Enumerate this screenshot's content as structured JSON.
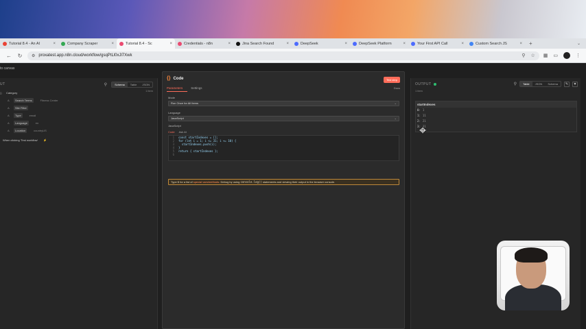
{
  "browser": {
    "tabs": [
      {
        "title": "Tutorial 8.4 - An AI",
        "color": "#ea4335",
        "active": false
      },
      {
        "title": "Company Scraper",
        "color": "#34a853",
        "active": false
      },
      {
        "title": "Tutorial 8.4 - Sc",
        "color": "#ea4b71",
        "active": true
      },
      {
        "title": "Credentials - n8n",
        "color": "#ea4b71",
        "active": false
      },
      {
        "title": "Jina Search Found",
        "color": "#111111",
        "active": false
      },
      {
        "title": "DeepSeek",
        "color": "#4d6bfe",
        "active": false
      },
      {
        "title": "DeepSeek Platform",
        "color": "#4d6bfe",
        "active": false
      },
      {
        "title": "Your First API Call",
        "color": "#4d6bfe",
        "active": false
      },
      {
        "title": "Custom Search JS",
        "color": "#4285f4",
        "active": false
      }
    ],
    "new_tab": "+",
    "url": "proxatest.app.n8n.cloud/workflow/gsqPtLl0xJl7Xwk"
  },
  "app": {
    "back_link": "to canvas",
    "input": {
      "title": "UT",
      "views": [
        "Schema",
        "Table",
        "JSON"
      ],
      "count": "1 item",
      "fields": [
        {
          "type": "{}",
          "key": "Category",
          "value": "",
          "sub": false
        },
        {
          "type": "A",
          "key": "Search Terms",
          "value": "Fitness Center",
          "sub": true
        },
        {
          "type": "A",
          "key": "Site Filter",
          "value": "",
          "sub": true
        },
        {
          "type": "A",
          "key": "Type",
          "value": "email",
          "sub": true
        },
        {
          "type": "A",
          "key": "Language",
          "value": "en",
          "sub": true
        },
        {
          "type": "A",
          "key": "Location",
          "value": "countryUS",
          "sub": true
        }
      ],
      "trigger": "When clicking 'Test workflow'"
    },
    "code": {
      "title": "Code",
      "test_button": "Test step",
      "docs": "Docs",
      "tabs": [
        "Parameters",
        "Settings"
      ],
      "mode_label": "Mode",
      "mode_value": "Run Once for All Items",
      "language_label": "Language",
      "language_value": "JavaScript",
      "js_label": "JavaScript",
      "editor_tabs": [
        "Code",
        "Ask AI"
      ],
      "lines": [
        {
          "n": "1",
          "code": "const startIndexes = [];"
        },
        {
          "n": "2",
          "code": "for (let i = 1; i <= 31; i += 10) {"
        },
        {
          "n": "3",
          "code": "  startIndexes.push(i);"
        },
        {
          "n": "4",
          "code": "}"
        },
        {
          "n": "5",
          "code": "return { startIndexes };"
        },
        {
          "n": "6",
          "code": ""
        }
      ],
      "hint_prefix": "Type $ for a list of",
      "hint_link": "special vars/methods",
      "hint_middle": ". Debug by using",
      "hint_code": "console.log()",
      "hint_suffix": "statements and viewing their output in the browser console."
    },
    "output": {
      "title": "OUTPUT",
      "views": [
        "Table",
        "JSON",
        "Schema"
      ],
      "count": "1 item",
      "column": "startIndexes",
      "rows": [
        {
          "i": "0",
          "v": "1"
        },
        {
          "i": "1",
          "v": "11"
        },
        {
          "i": "2",
          "v": "21"
        },
        {
          "i": "3",
          "v": "31"
        }
      ]
    }
  }
}
